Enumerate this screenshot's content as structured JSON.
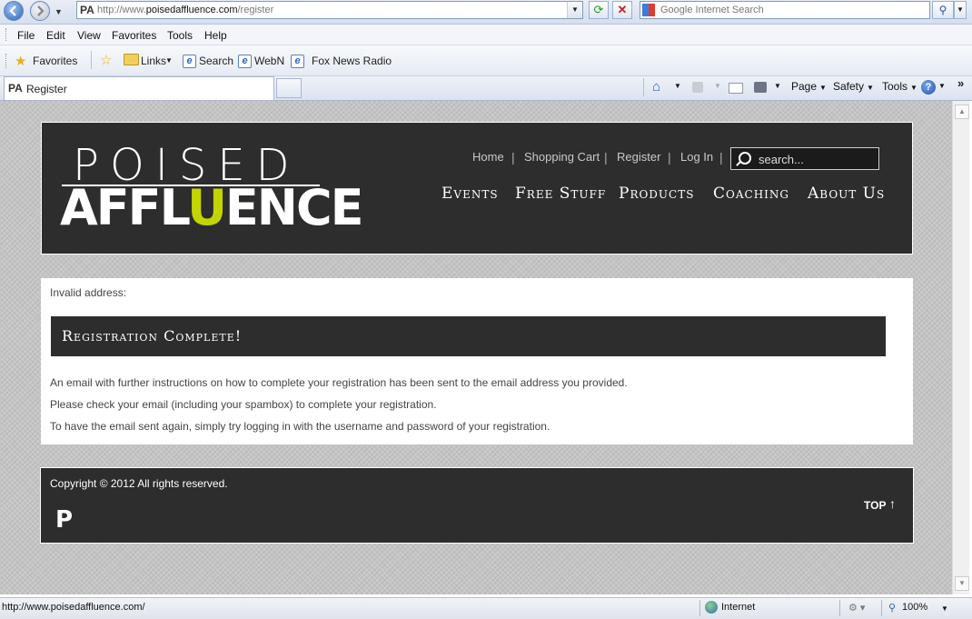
{
  "browser": {
    "url_prefix": "http://www.",
    "url_domain": "poisedaffluence.com",
    "url_path": "/register",
    "search_placeholder": "Google Internet Search",
    "favicon": "PA",
    "menu": [
      "File",
      "Edit",
      "View",
      "Favorites",
      "Tools",
      "Help"
    ],
    "favorites_label": "Favorites",
    "favorites_links": [
      "Links",
      "Search",
      "WebN",
      "Fox News Radio"
    ],
    "tab_title": "Register",
    "commands": [
      "Page",
      "Safety",
      "Tools"
    ],
    "overflow": "»",
    "status_url": "http://www.poisedaffluence.com/",
    "zone": "Internet",
    "zoom": "100%"
  },
  "site": {
    "logo_top": "POISED",
    "logo_bottom_pre": "AFFL",
    "logo_bottom_hl": "U",
    "logo_bottom_post": "ENCE",
    "top_nav": [
      "Home",
      "Shopping Cart",
      "Register",
      "Log In"
    ],
    "search_placeholder": "search...",
    "main_nav": [
      "Events",
      "Free Stuff",
      "Products",
      "Coaching",
      "About Us"
    ]
  },
  "content": {
    "invalid_text": "Invalid address:",
    "banner": "Registration Complete!",
    "paragraphs": [
      "An email with further instructions on how to complete your registration has been sent to the email address you provided.",
      "Please check your email (including your spambox) to complete your registration.",
      "To have the email sent again, simply try logging in with the username and password of your registration."
    ]
  },
  "footer": {
    "copyright": "Copyright © 2012 All rights reserved.",
    "logo": "P",
    "top_label": "TOP",
    "top_arrow": "↑"
  },
  "colors": {
    "accent": "#c3d500",
    "dark": "#2d2d2d",
    "background": "#c4c4c4"
  }
}
